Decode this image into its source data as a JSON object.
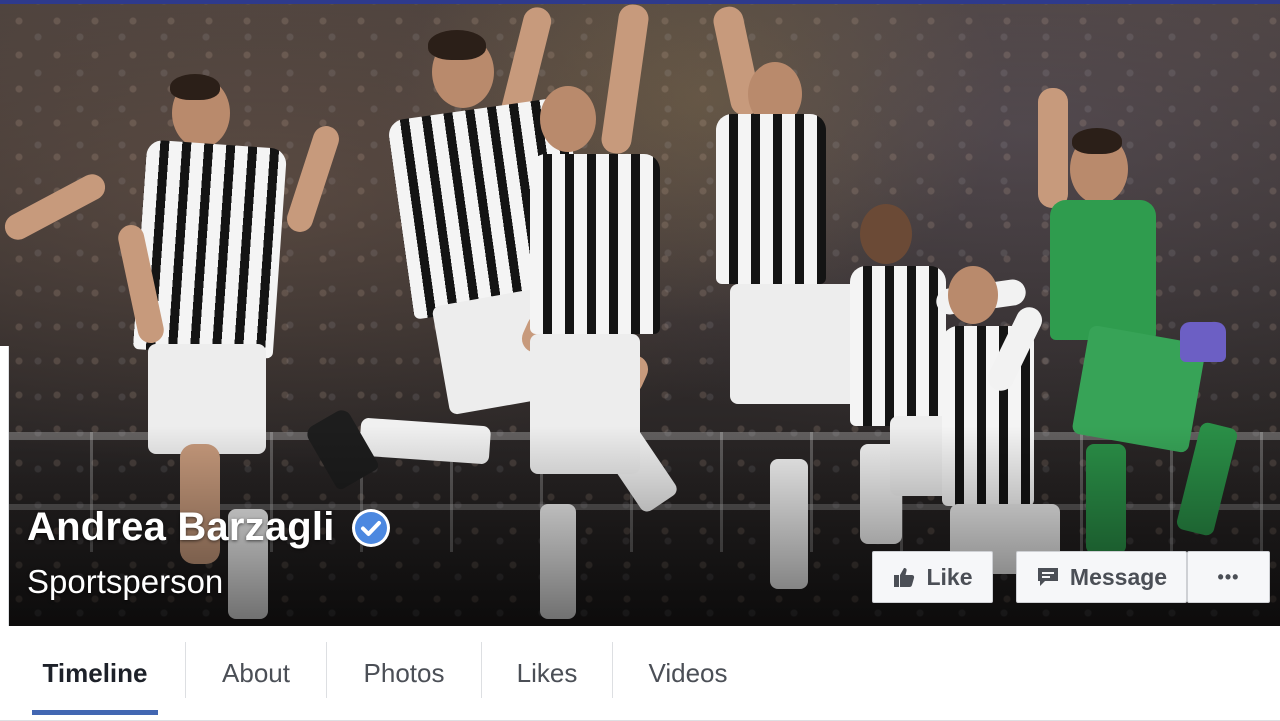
{
  "profile": {
    "name": "Andrea Barzagli",
    "category": "Sportsperson",
    "verified": true
  },
  "actions": {
    "like_label": "Like",
    "message_label": "Message",
    "more_label": "•••"
  },
  "tabs": [
    {
      "label": "Timeline",
      "active": true
    },
    {
      "label": "About",
      "active": false
    },
    {
      "label": "Photos",
      "active": false
    },
    {
      "label": "Likes",
      "active": false
    },
    {
      "label": "Videos",
      "active": false
    }
  ],
  "icons": {
    "verified": "verified-check-icon",
    "like": "thumbs-up-icon",
    "message": "speech-bubble-icon"
  },
  "colors": {
    "accent": "#4267b2",
    "verified_badge": "#4c88e0",
    "header_bar": "#2e3a8c"
  }
}
